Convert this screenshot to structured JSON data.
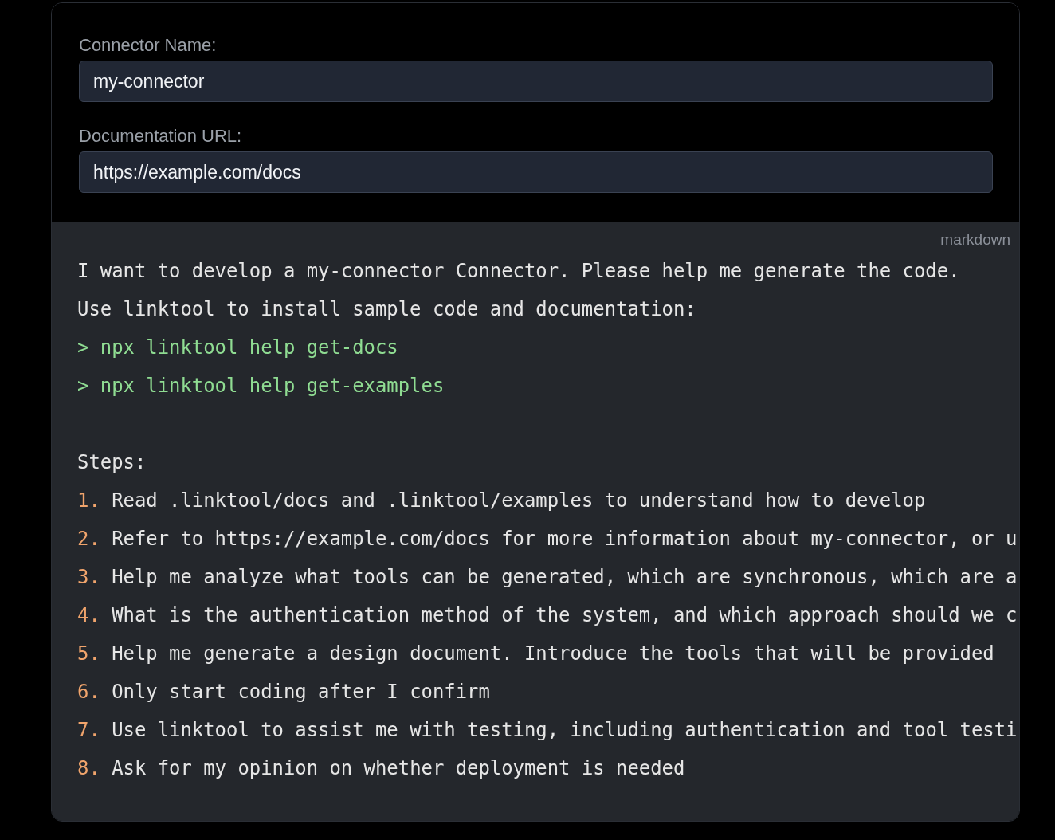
{
  "form": {
    "fields": [
      {
        "label": "Connector Name:",
        "value": "my-connector"
      },
      {
        "label": "Documentation URL:",
        "value": "https://example.com/docs"
      }
    ]
  },
  "code_block": {
    "language": "markdown",
    "intro": [
      "I want to develop a my-connector Connector. Please help me generate the code.",
      "Use linktool to install sample code and documentation:"
    ],
    "commands": [
      "> npx linktool help get-docs",
      "> npx linktool help get-examples"
    ],
    "steps_heading": "Steps:",
    "steps": [
      {
        "number": "1.",
        "text": "Read .linktool/docs and .linktool/examples to understand how to develop"
      },
      {
        "number": "2.",
        "text": "Refer to https://example.com/docs for more information about my-connector, or u"
      },
      {
        "number": "3.",
        "text": "Help me analyze what tools can be generated, which are synchronous, which are a"
      },
      {
        "number": "4.",
        "text": "What is the authentication method of the system, and which approach should we c"
      },
      {
        "number": "5.",
        "text": "Help me generate a design document. Introduce the tools that will be provided"
      },
      {
        "number": "6.",
        "text": "Only start coding after I confirm"
      },
      {
        "number": "7.",
        "text": "Use linktool to assist me with testing, including authentication and tool testi"
      },
      {
        "number": "8.",
        "text": "Ask for my opinion on whether deployment is needed"
      }
    ]
  }
}
